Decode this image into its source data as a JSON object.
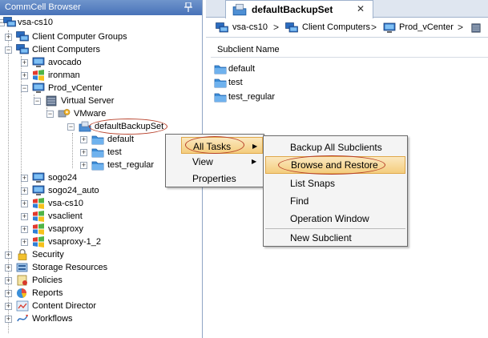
{
  "left_pane": {
    "title": "CommCell Browser",
    "tree": {
      "root": "vsa-cs10",
      "client_computer_groups": "Client Computer Groups",
      "client_computers": "Client Computers",
      "avocado": "avocado",
      "ironman": "ironman",
      "prod_vcenter": "Prod_vCenter",
      "virtual_server": "Virtual Server",
      "vmware": "VMware",
      "default_backup_set": "defaultBackupSet",
      "default": "default",
      "test": "test",
      "test_regular": "test_regular",
      "sogo24": "sogo24",
      "sogo24_auto": "sogo24_auto",
      "vsa_cs10": "vsa-cs10",
      "vsaclient": "vsaclient",
      "vsaproxy": "vsaproxy",
      "vsaproxy_1_2": "vsaproxy-1_2",
      "security": "Security",
      "storage_resources": "Storage Resources",
      "policies": "Policies",
      "reports": "Reports",
      "content_director": "Content Director",
      "workflows": "Workflows"
    }
  },
  "right_pane": {
    "tab_label": "defaultBackupSet",
    "tab_close": "✕",
    "breadcrumb": {
      "c1": "vsa-cs10",
      "c2": "Client Computers",
      "c3": "Prod_vCenter",
      "sep": ">"
    },
    "column_header": "Subclient Name",
    "items": [
      "default",
      "test",
      "test_regular"
    ]
  },
  "context_menu": {
    "all_tasks": "All Tasks",
    "view": "View",
    "properties": "Properties"
  },
  "submenu": {
    "backup_all": "Backup All Subclients",
    "browse_restore": "Browse and Restore",
    "list_snaps": "List Snaps",
    "find": "Find",
    "operation_window": "Operation Window",
    "new_subclient": "New Subclient"
  },
  "colors": {
    "header_blue": "#4872b8",
    "highlight": "#f4cd7d",
    "annotation_red": "#b7402a",
    "folder_blue": "#3d8ed8"
  }
}
